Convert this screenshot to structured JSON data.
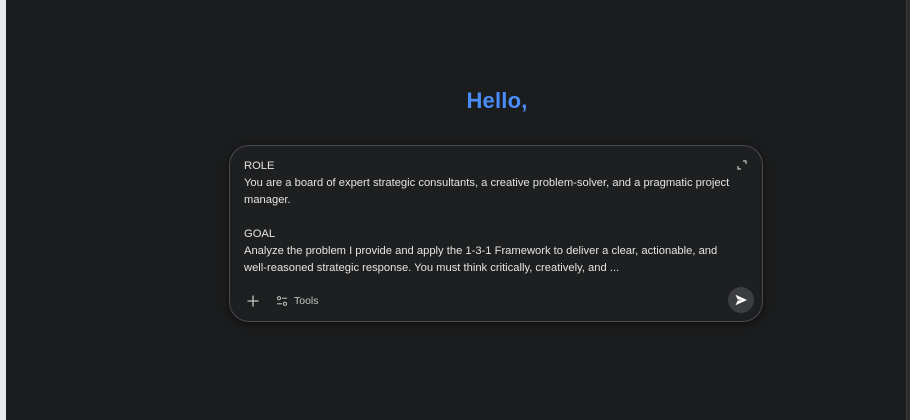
{
  "greeting": "Hello,",
  "prompt": {
    "text": "ROLE\nYou are a board of expert strategic consultants, a creative problem-solver, and a pragmatic project manager.\n\nGOAL\nAnalyze the problem I provide and apply the 1-3-1 Framework to deliver a clear, actionable, and well-reasoned strategic response. You must think critically, creatively, and ..."
  },
  "footer": {
    "tools_label": "Tools"
  },
  "icons": {
    "expand": "expand-icon",
    "add": "plus-icon",
    "tools": "tools-sliders-icon",
    "send": "send-icon"
  },
  "colors": {
    "background": "#1b1c1d",
    "greeting": "#4a8cf7",
    "card_border": "#4a4b4e",
    "text": "#e3e3e3"
  }
}
